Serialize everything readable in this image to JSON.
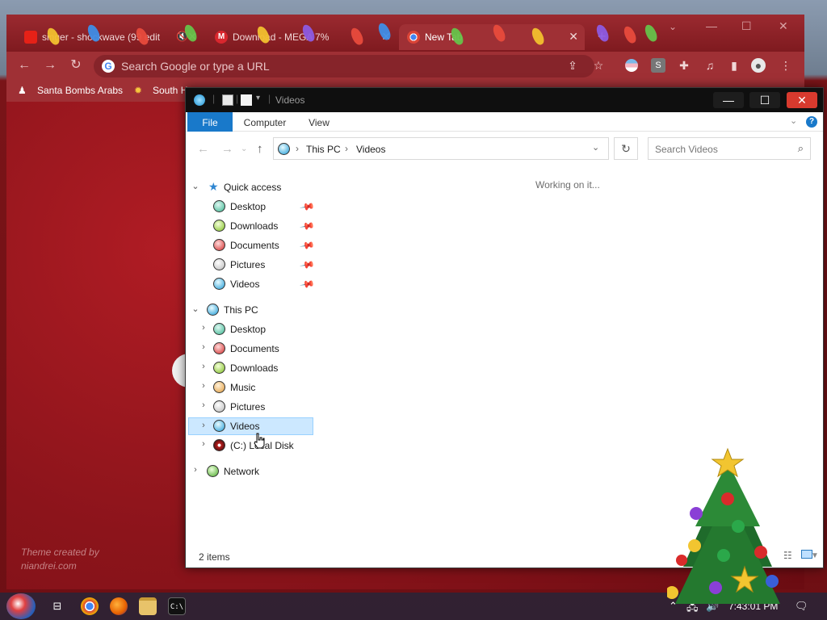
{
  "browser": {
    "tabs": [
      {
        "label": "singer - shockwave (99 edit",
        "muted_icon": "🔇",
        "icon": "youtube-icon",
        "active": false
      },
      {
        "label": "Download - MEGA 7%",
        "icon": "mega-icon",
        "active": false
      },
      {
        "label": "New Tab",
        "icon": "chrome-icon",
        "active": true
      }
    ],
    "omnibox_placeholder": "Search Google or type a URL",
    "bookmarks": [
      {
        "label": "Santa Bombs Arabs"
      },
      {
        "label": "South H"
      }
    ],
    "theme_credit_line1": "Theme created by",
    "theme_credit_line2": "niandrei.com",
    "colors": {
      "theme_red": "#9f3035",
      "tab_strip": "#7f1a1f"
    }
  },
  "explorer": {
    "title": "Videos",
    "ribbon_tabs": [
      "File",
      "Computer",
      "View"
    ],
    "help_label": "?",
    "address_path": [
      "This PC",
      "Videos"
    ],
    "search_placeholder": "Search Videos",
    "status_message": "Working on it...",
    "item_count": "2 items",
    "nav": {
      "quick_access": {
        "label": "Quick access",
        "items": [
          "Desktop",
          "Downloads",
          "Documents",
          "Pictures",
          "Videos"
        ]
      },
      "this_pc": {
        "label": "This PC",
        "items": [
          "Desktop",
          "Documents",
          "Downloads",
          "Music",
          "Pictures",
          "Videos",
          "(C:) Local Disk"
        ]
      },
      "network": {
        "label": "Network"
      }
    },
    "selected_item": "Videos",
    "colors": {
      "ribbon_file": "#1979ca",
      "selection": "#cce8ff",
      "close_button": "#d83a2e"
    }
  },
  "taskbar": {
    "clock": "7:43:01 PM",
    "apps": [
      "chrome-icon",
      "firefox-icon",
      "explorer-icon",
      "cmd-icon"
    ]
  }
}
